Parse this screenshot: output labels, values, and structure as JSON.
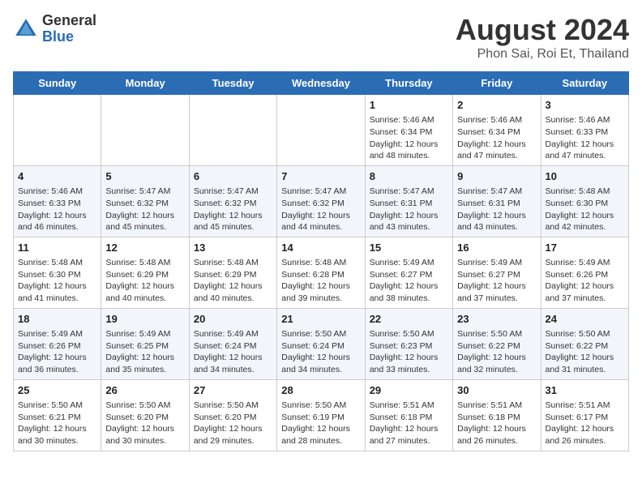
{
  "header": {
    "logo_general": "General",
    "logo_blue": "Blue",
    "title": "August 2024",
    "subtitle": "Phon Sai, Roi Et, Thailand"
  },
  "days_of_week": [
    "Sunday",
    "Monday",
    "Tuesday",
    "Wednesday",
    "Thursday",
    "Friday",
    "Saturday"
  ],
  "weeks": [
    [
      {
        "day": "",
        "info": ""
      },
      {
        "day": "",
        "info": ""
      },
      {
        "day": "",
        "info": ""
      },
      {
        "day": "",
        "info": ""
      },
      {
        "day": "1",
        "info": "Sunrise: 5:46 AM\nSunset: 6:34 PM\nDaylight: 12 hours and 48 minutes."
      },
      {
        "day": "2",
        "info": "Sunrise: 5:46 AM\nSunset: 6:34 PM\nDaylight: 12 hours and 47 minutes."
      },
      {
        "day": "3",
        "info": "Sunrise: 5:46 AM\nSunset: 6:33 PM\nDaylight: 12 hours and 47 minutes."
      }
    ],
    [
      {
        "day": "4",
        "info": "Sunrise: 5:46 AM\nSunset: 6:33 PM\nDaylight: 12 hours and 46 minutes."
      },
      {
        "day": "5",
        "info": "Sunrise: 5:47 AM\nSunset: 6:32 PM\nDaylight: 12 hours and 45 minutes."
      },
      {
        "day": "6",
        "info": "Sunrise: 5:47 AM\nSunset: 6:32 PM\nDaylight: 12 hours and 45 minutes."
      },
      {
        "day": "7",
        "info": "Sunrise: 5:47 AM\nSunset: 6:32 PM\nDaylight: 12 hours and 44 minutes."
      },
      {
        "day": "8",
        "info": "Sunrise: 5:47 AM\nSunset: 6:31 PM\nDaylight: 12 hours and 43 minutes."
      },
      {
        "day": "9",
        "info": "Sunrise: 5:47 AM\nSunset: 6:31 PM\nDaylight: 12 hours and 43 minutes."
      },
      {
        "day": "10",
        "info": "Sunrise: 5:48 AM\nSunset: 6:30 PM\nDaylight: 12 hours and 42 minutes."
      }
    ],
    [
      {
        "day": "11",
        "info": "Sunrise: 5:48 AM\nSunset: 6:30 PM\nDaylight: 12 hours and 41 minutes."
      },
      {
        "day": "12",
        "info": "Sunrise: 5:48 AM\nSunset: 6:29 PM\nDaylight: 12 hours and 40 minutes."
      },
      {
        "day": "13",
        "info": "Sunrise: 5:48 AM\nSunset: 6:29 PM\nDaylight: 12 hours and 40 minutes."
      },
      {
        "day": "14",
        "info": "Sunrise: 5:48 AM\nSunset: 6:28 PM\nDaylight: 12 hours and 39 minutes."
      },
      {
        "day": "15",
        "info": "Sunrise: 5:49 AM\nSunset: 6:27 PM\nDaylight: 12 hours and 38 minutes."
      },
      {
        "day": "16",
        "info": "Sunrise: 5:49 AM\nSunset: 6:27 PM\nDaylight: 12 hours and 37 minutes."
      },
      {
        "day": "17",
        "info": "Sunrise: 5:49 AM\nSunset: 6:26 PM\nDaylight: 12 hours and 37 minutes."
      }
    ],
    [
      {
        "day": "18",
        "info": "Sunrise: 5:49 AM\nSunset: 6:26 PM\nDaylight: 12 hours and 36 minutes."
      },
      {
        "day": "19",
        "info": "Sunrise: 5:49 AM\nSunset: 6:25 PM\nDaylight: 12 hours and 35 minutes."
      },
      {
        "day": "20",
        "info": "Sunrise: 5:49 AM\nSunset: 6:24 PM\nDaylight: 12 hours and 34 minutes."
      },
      {
        "day": "21",
        "info": "Sunrise: 5:50 AM\nSunset: 6:24 PM\nDaylight: 12 hours and 34 minutes."
      },
      {
        "day": "22",
        "info": "Sunrise: 5:50 AM\nSunset: 6:23 PM\nDaylight: 12 hours and 33 minutes."
      },
      {
        "day": "23",
        "info": "Sunrise: 5:50 AM\nSunset: 6:22 PM\nDaylight: 12 hours and 32 minutes."
      },
      {
        "day": "24",
        "info": "Sunrise: 5:50 AM\nSunset: 6:22 PM\nDaylight: 12 hours and 31 minutes."
      }
    ],
    [
      {
        "day": "25",
        "info": "Sunrise: 5:50 AM\nSunset: 6:21 PM\nDaylight: 12 hours and 30 minutes."
      },
      {
        "day": "26",
        "info": "Sunrise: 5:50 AM\nSunset: 6:20 PM\nDaylight: 12 hours and 30 minutes."
      },
      {
        "day": "27",
        "info": "Sunrise: 5:50 AM\nSunset: 6:20 PM\nDaylight: 12 hours and 29 minutes."
      },
      {
        "day": "28",
        "info": "Sunrise: 5:50 AM\nSunset: 6:19 PM\nDaylight: 12 hours and 28 minutes."
      },
      {
        "day": "29",
        "info": "Sunrise: 5:51 AM\nSunset: 6:18 PM\nDaylight: 12 hours and 27 minutes."
      },
      {
        "day": "30",
        "info": "Sunrise: 5:51 AM\nSunset: 6:18 PM\nDaylight: 12 hours and 26 minutes."
      },
      {
        "day": "31",
        "info": "Sunrise: 5:51 AM\nSunset: 6:17 PM\nDaylight: 12 hours and 26 minutes."
      }
    ]
  ]
}
